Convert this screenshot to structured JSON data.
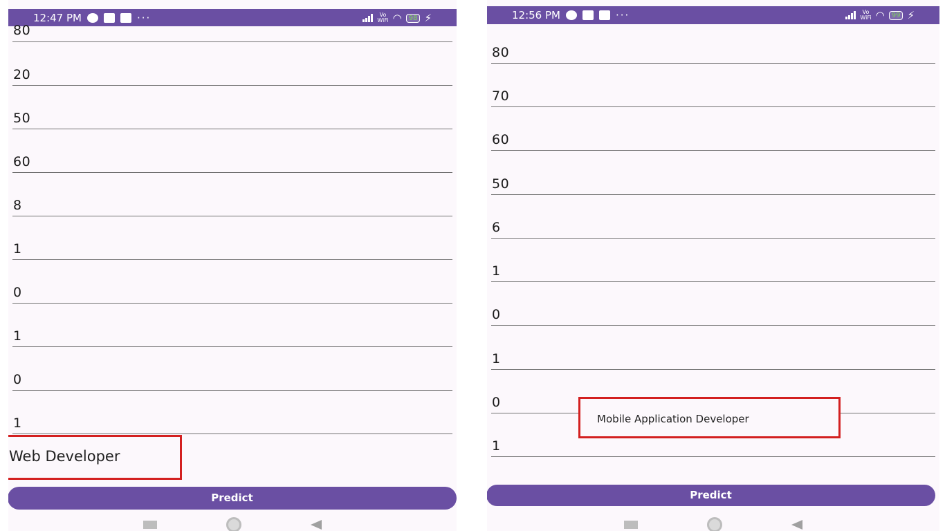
{
  "left": {
    "status": {
      "time": "12:47 PM",
      "dots": "···",
      "volte": [
        "Vo",
        "WiFi"
      ],
      "battery": "98"
    },
    "fields": [
      "80",
      "20",
      "50",
      "60",
      "8",
      "1",
      "0",
      "1",
      "0",
      "1"
    ],
    "result": "Web Developer",
    "predict_label": "Predict"
  },
  "right": {
    "status": {
      "time": "12:56 PM",
      "dots": "···",
      "volte": [
        "Vo",
        "WiFi"
      ],
      "battery": "99"
    },
    "fields": [
      "80",
      "70",
      "60",
      "50",
      "6",
      "1",
      "0",
      "1",
      "0",
      "1"
    ],
    "result": "Mobile Application Developer",
    "predict_label": "Predict"
  },
  "colors": {
    "primary": "#6a4fa3",
    "highlight": "#d32020",
    "background": "#fcf8fc"
  }
}
